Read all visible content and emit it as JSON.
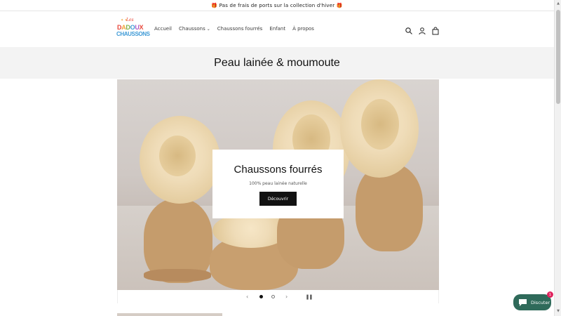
{
  "announcement": {
    "text": "🎁 Pas de frais de ports sur la collection d'hiver 🎁"
  },
  "header": {
    "logo_top": "Les",
    "logo_line1": [
      "D",
      "A",
      "D",
      "O",
      "U",
      "X"
    ],
    "logo_line2": "CHAUSSONS",
    "nav": [
      {
        "label": "Accueil",
        "has_dropdown": false
      },
      {
        "label": "Chaussons",
        "has_dropdown": true
      },
      {
        "label": "Chaussons fourrés",
        "has_dropdown": false
      },
      {
        "label": "Enfant",
        "has_dropdown": false
      },
      {
        "label": "À propos",
        "has_dropdown": false
      }
    ],
    "icons": [
      "search-icon",
      "account-icon",
      "cart-icon"
    ]
  },
  "page_title": "Peau lainée & moumoute",
  "hero": {
    "title": "Chaussons fourrés",
    "subtitle": "100% peau lainée naturelle",
    "button": "Découvrir"
  },
  "slideshow": {
    "prev": "‹",
    "next": "›",
    "pause": "❚❚",
    "current_slide": 1,
    "slide_count": 2
  },
  "chat": {
    "label": "Discuter",
    "badge": "1"
  },
  "colors": {
    "chat_bg": "#2f6a5a",
    "button_bg": "#121212",
    "band_bg": "#f3f3f3"
  }
}
